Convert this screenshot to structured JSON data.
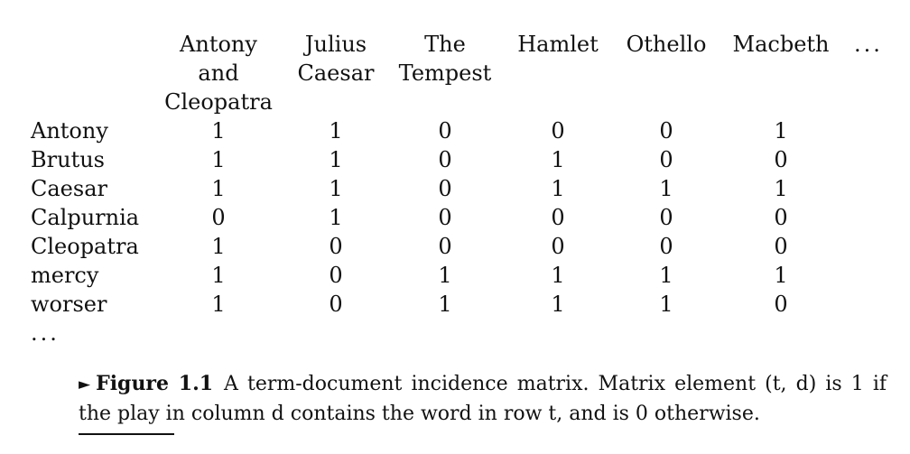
{
  "matrix": {
    "columns": [
      "Antony\nand\nCleopatra",
      "Julius\nCaesar",
      "The\nTempest",
      "Hamlet",
      "Othello",
      "Macbeth"
    ],
    "column_ellipsis": "...",
    "rows": [
      {
        "term": "Antony",
        "values": [
          "1",
          "1",
          "0",
          "0",
          "0",
          "1"
        ]
      },
      {
        "term": "Brutus",
        "values": [
          "1",
          "1",
          "0",
          "1",
          "0",
          "0"
        ]
      },
      {
        "term": "Caesar",
        "values": [
          "1",
          "1",
          "0",
          "1",
          "1",
          "1"
        ]
      },
      {
        "term": "Calpurnia",
        "values": [
          "0",
          "1",
          "0",
          "0",
          "0",
          "0"
        ]
      },
      {
        "term": "Cleopatra",
        "values": [
          "1",
          "0",
          "0",
          "0",
          "0",
          "0"
        ]
      },
      {
        "term": "mercy",
        "values": [
          "1",
          "0",
          "1",
          "1",
          "1",
          "1"
        ]
      },
      {
        "term": "worser",
        "values": [
          "1",
          "0",
          "1",
          "1",
          "1",
          "0"
        ]
      }
    ],
    "row_ellipsis": "..."
  },
  "caption": {
    "marker": "►",
    "label": "Figure 1.1",
    "text": "A term-document incidence matrix. Matrix element (t, d) is 1 if the play in column d contains the word in row t, and is 0 otherwise."
  }
}
